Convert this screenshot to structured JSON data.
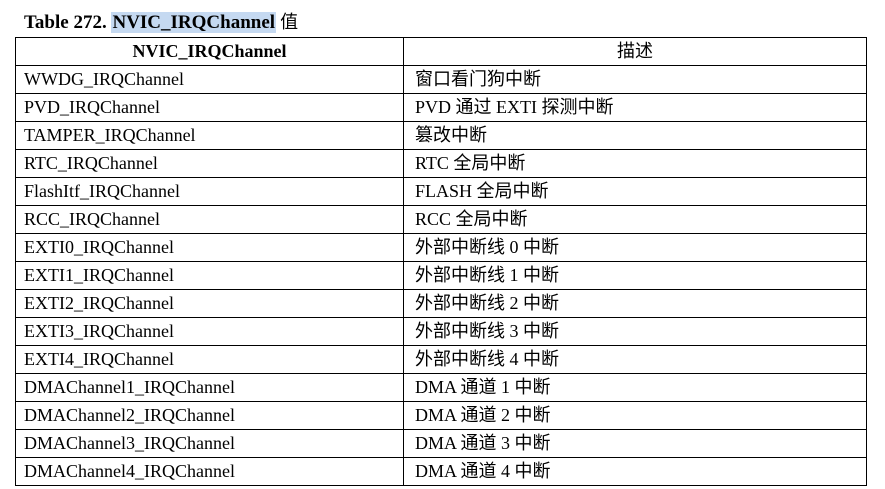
{
  "caption": {
    "prefix": "Table 272. ",
    "highlight": "NVIC_IRQChannel",
    "suffix": "值",
    "highlight_color": "#c5d9f1"
  },
  "table": {
    "headers": [
      "NVIC_IRQChannel",
      "描述"
    ],
    "rows": [
      {
        "channel": "WWDG_IRQChannel",
        "description": "窗口看门狗中断"
      },
      {
        "channel": "PVD_IRQChannel",
        "description": "PVD 通过 EXTI 探测中断"
      },
      {
        "channel": "TAMPER_IRQChannel",
        "description": "篡改中断"
      },
      {
        "channel": "RTC_IRQChannel",
        "description": "RTC 全局中断"
      },
      {
        "channel": "FlashItf_IRQChannel",
        "description": "FLASH 全局中断"
      },
      {
        "channel": "RCC_IRQChannel",
        "description": "RCC 全局中断"
      },
      {
        "channel": "EXTI0_IRQChannel",
        "description": "外部中断线 0 中断"
      },
      {
        "channel": "EXTI1_IRQChannel",
        "description": "外部中断线 1 中断"
      },
      {
        "channel": "EXTI2_IRQChannel",
        "description": "外部中断线 2 中断"
      },
      {
        "channel": "EXTI3_IRQChannel",
        "description": "外部中断线 3 中断"
      },
      {
        "channel": "EXTI4_IRQChannel",
        "description": "外部中断线 4 中断"
      },
      {
        "channel": "DMAChannel1_IRQChannel",
        "description": "DMA 通道 1 中断"
      },
      {
        "channel": "DMAChannel2_IRQChannel",
        "description": "DMA 通道 2 中断"
      },
      {
        "channel": "DMAChannel3_IRQChannel",
        "description": "DMA 通道 3 中断"
      },
      {
        "channel": "DMAChannel4_IRQChannel",
        "description": "DMA 通道 4 中断"
      }
    ]
  }
}
